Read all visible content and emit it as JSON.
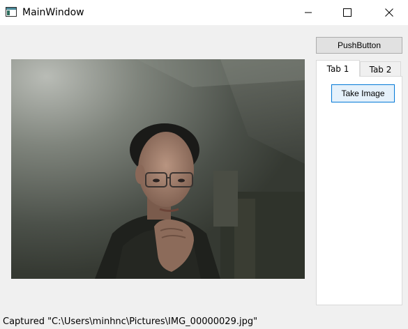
{
  "window": {
    "title": "MainWindow"
  },
  "icons": {
    "app": "app-window-icon",
    "minimize": "minimize-icon",
    "maximize": "maximize-icon",
    "close": "close-icon"
  },
  "controls": {
    "push_button_label": "PushButton",
    "take_image_label": "Take Image"
  },
  "tabs": [
    {
      "label": "Tab 1",
      "selected": true
    },
    {
      "label": "Tab 2",
      "selected": false
    }
  ],
  "status_bar": {
    "message": "Captured \"C:\\Users\\minhnc\\Pictures\\IMG_00000029.jpg\""
  },
  "colors": {
    "window_bg": "#f0f0f0",
    "titlebar_bg": "#ffffff",
    "accent_border": "#0078d7",
    "accent_fill": "#e5f1fb"
  }
}
